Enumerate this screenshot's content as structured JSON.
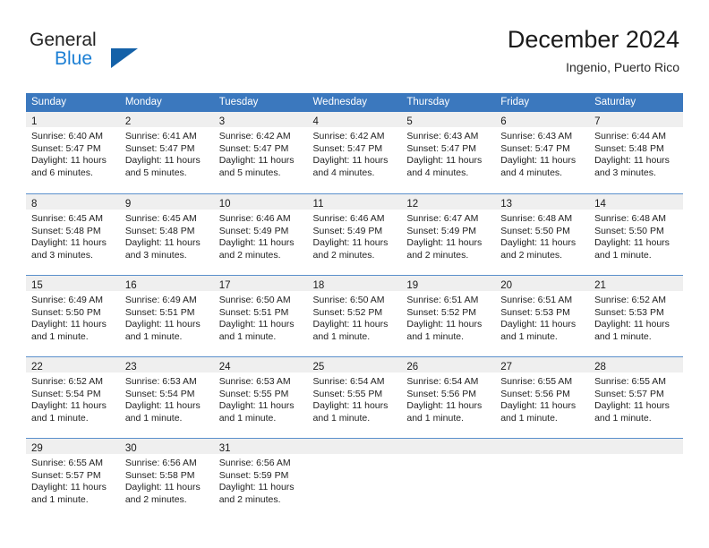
{
  "brand": {
    "name_part1": "General",
    "name_part2": "Blue"
  },
  "header": {
    "title": "December 2024",
    "subtitle": "Ingenio, Puerto Rico"
  },
  "colors": {
    "header_blue": "#3b78be",
    "row_divider_blue": "#5b90cc",
    "daynum_band": "#efefef",
    "brand_blue": "#1c7fd4",
    "brand_dark": "#232323"
  },
  "weekdays": [
    "Sunday",
    "Monday",
    "Tuesday",
    "Wednesday",
    "Thursday",
    "Friday",
    "Saturday"
  ],
  "weeks": [
    [
      {
        "day": "1",
        "sunrise": "Sunrise: 6:40 AM",
        "sunset": "Sunset: 5:47 PM",
        "daylight1": "Daylight: 11 hours",
        "daylight2": "and 6 minutes."
      },
      {
        "day": "2",
        "sunrise": "Sunrise: 6:41 AM",
        "sunset": "Sunset: 5:47 PM",
        "daylight1": "Daylight: 11 hours",
        "daylight2": "and 5 minutes."
      },
      {
        "day": "3",
        "sunrise": "Sunrise: 6:42 AM",
        "sunset": "Sunset: 5:47 PM",
        "daylight1": "Daylight: 11 hours",
        "daylight2": "and 5 minutes."
      },
      {
        "day": "4",
        "sunrise": "Sunrise: 6:42 AM",
        "sunset": "Sunset: 5:47 PM",
        "daylight1": "Daylight: 11 hours",
        "daylight2": "and 4 minutes."
      },
      {
        "day": "5",
        "sunrise": "Sunrise: 6:43 AM",
        "sunset": "Sunset: 5:47 PM",
        "daylight1": "Daylight: 11 hours",
        "daylight2": "and 4 minutes."
      },
      {
        "day": "6",
        "sunrise": "Sunrise: 6:43 AM",
        "sunset": "Sunset: 5:47 PM",
        "daylight1": "Daylight: 11 hours",
        "daylight2": "and 4 minutes."
      },
      {
        "day": "7",
        "sunrise": "Sunrise: 6:44 AM",
        "sunset": "Sunset: 5:48 PM",
        "daylight1": "Daylight: 11 hours",
        "daylight2": "and 3 minutes."
      }
    ],
    [
      {
        "day": "8",
        "sunrise": "Sunrise: 6:45 AM",
        "sunset": "Sunset: 5:48 PM",
        "daylight1": "Daylight: 11 hours",
        "daylight2": "and 3 minutes."
      },
      {
        "day": "9",
        "sunrise": "Sunrise: 6:45 AM",
        "sunset": "Sunset: 5:48 PM",
        "daylight1": "Daylight: 11 hours",
        "daylight2": "and 3 minutes."
      },
      {
        "day": "10",
        "sunrise": "Sunrise: 6:46 AM",
        "sunset": "Sunset: 5:49 PM",
        "daylight1": "Daylight: 11 hours",
        "daylight2": "and 2 minutes."
      },
      {
        "day": "11",
        "sunrise": "Sunrise: 6:46 AM",
        "sunset": "Sunset: 5:49 PM",
        "daylight1": "Daylight: 11 hours",
        "daylight2": "and 2 minutes."
      },
      {
        "day": "12",
        "sunrise": "Sunrise: 6:47 AM",
        "sunset": "Sunset: 5:49 PM",
        "daylight1": "Daylight: 11 hours",
        "daylight2": "and 2 minutes."
      },
      {
        "day": "13",
        "sunrise": "Sunrise: 6:48 AM",
        "sunset": "Sunset: 5:50 PM",
        "daylight1": "Daylight: 11 hours",
        "daylight2": "and 2 minutes."
      },
      {
        "day": "14",
        "sunrise": "Sunrise: 6:48 AM",
        "sunset": "Sunset: 5:50 PM",
        "daylight1": "Daylight: 11 hours",
        "daylight2": "and 1 minute."
      }
    ],
    [
      {
        "day": "15",
        "sunrise": "Sunrise: 6:49 AM",
        "sunset": "Sunset: 5:50 PM",
        "daylight1": "Daylight: 11 hours",
        "daylight2": "and 1 minute."
      },
      {
        "day": "16",
        "sunrise": "Sunrise: 6:49 AM",
        "sunset": "Sunset: 5:51 PM",
        "daylight1": "Daylight: 11 hours",
        "daylight2": "and 1 minute."
      },
      {
        "day": "17",
        "sunrise": "Sunrise: 6:50 AM",
        "sunset": "Sunset: 5:51 PM",
        "daylight1": "Daylight: 11 hours",
        "daylight2": "and 1 minute."
      },
      {
        "day": "18",
        "sunrise": "Sunrise: 6:50 AM",
        "sunset": "Sunset: 5:52 PM",
        "daylight1": "Daylight: 11 hours",
        "daylight2": "and 1 minute."
      },
      {
        "day": "19",
        "sunrise": "Sunrise: 6:51 AM",
        "sunset": "Sunset: 5:52 PM",
        "daylight1": "Daylight: 11 hours",
        "daylight2": "and 1 minute."
      },
      {
        "day": "20",
        "sunrise": "Sunrise: 6:51 AM",
        "sunset": "Sunset: 5:53 PM",
        "daylight1": "Daylight: 11 hours",
        "daylight2": "and 1 minute."
      },
      {
        "day": "21",
        "sunrise": "Sunrise: 6:52 AM",
        "sunset": "Sunset: 5:53 PM",
        "daylight1": "Daylight: 11 hours",
        "daylight2": "and 1 minute."
      }
    ],
    [
      {
        "day": "22",
        "sunrise": "Sunrise: 6:52 AM",
        "sunset": "Sunset: 5:54 PM",
        "daylight1": "Daylight: 11 hours",
        "daylight2": "and 1 minute."
      },
      {
        "day": "23",
        "sunrise": "Sunrise: 6:53 AM",
        "sunset": "Sunset: 5:54 PM",
        "daylight1": "Daylight: 11 hours",
        "daylight2": "and 1 minute."
      },
      {
        "day": "24",
        "sunrise": "Sunrise: 6:53 AM",
        "sunset": "Sunset: 5:55 PM",
        "daylight1": "Daylight: 11 hours",
        "daylight2": "and 1 minute."
      },
      {
        "day": "25",
        "sunrise": "Sunrise: 6:54 AM",
        "sunset": "Sunset: 5:55 PM",
        "daylight1": "Daylight: 11 hours",
        "daylight2": "and 1 minute."
      },
      {
        "day": "26",
        "sunrise": "Sunrise: 6:54 AM",
        "sunset": "Sunset: 5:56 PM",
        "daylight1": "Daylight: 11 hours",
        "daylight2": "and 1 minute."
      },
      {
        "day": "27",
        "sunrise": "Sunrise: 6:55 AM",
        "sunset": "Sunset: 5:56 PM",
        "daylight1": "Daylight: 11 hours",
        "daylight2": "and 1 minute."
      },
      {
        "day": "28",
        "sunrise": "Sunrise: 6:55 AM",
        "sunset": "Sunset: 5:57 PM",
        "daylight1": "Daylight: 11 hours",
        "daylight2": "and 1 minute."
      }
    ],
    [
      {
        "day": "29",
        "sunrise": "Sunrise: 6:55 AM",
        "sunset": "Sunset: 5:57 PM",
        "daylight1": "Daylight: 11 hours",
        "daylight2": "and 1 minute."
      },
      {
        "day": "30",
        "sunrise": "Sunrise: 6:56 AM",
        "sunset": "Sunset: 5:58 PM",
        "daylight1": "Daylight: 11 hours",
        "daylight2": "and 2 minutes."
      },
      {
        "day": "31",
        "sunrise": "Sunrise: 6:56 AM",
        "sunset": "Sunset: 5:59 PM",
        "daylight1": "Daylight: 11 hours",
        "daylight2": "and 2 minutes."
      },
      {
        "day": "",
        "sunrise": "",
        "sunset": "",
        "daylight1": "",
        "daylight2": ""
      },
      {
        "day": "",
        "sunrise": "",
        "sunset": "",
        "daylight1": "",
        "daylight2": ""
      },
      {
        "day": "",
        "sunrise": "",
        "sunset": "",
        "daylight1": "",
        "daylight2": ""
      },
      {
        "day": "",
        "sunrise": "",
        "sunset": "",
        "daylight1": "",
        "daylight2": ""
      }
    ]
  ]
}
